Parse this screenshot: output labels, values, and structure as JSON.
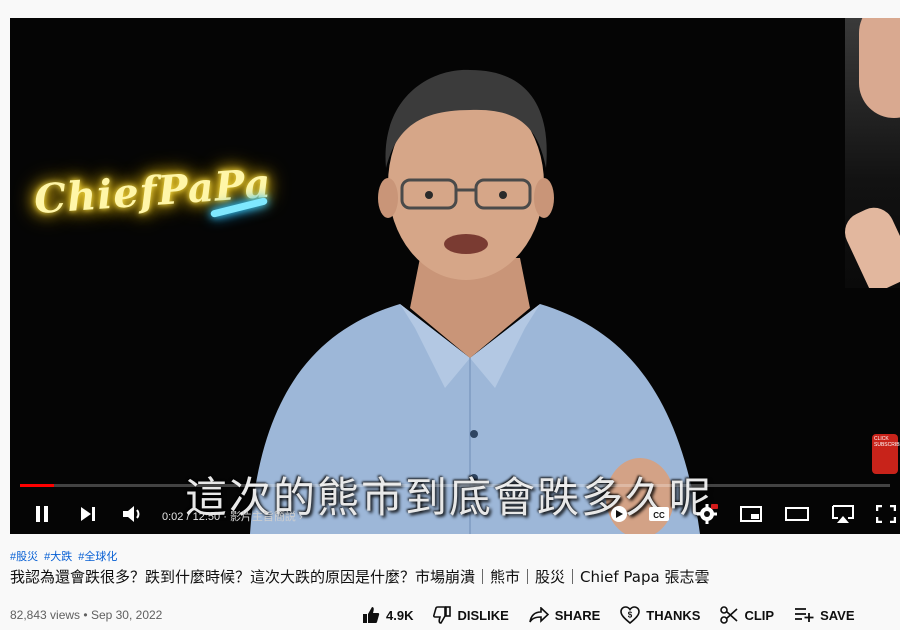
{
  "video": {
    "neon_sign": "ChiefPaPa",
    "subtitle": "這次的熊市到底會跌多久呢",
    "subscribe_badge": "CLICK SUBSCRIBE",
    "progress_fraction": 0.004
  },
  "controls": {
    "current_time": "0:02",
    "duration": "12:50",
    "chapter": "影片主旨簡説",
    "chapter_chevron": "›"
  },
  "info": {
    "tags": [
      "#股災",
      "#大跌",
      "#全球化"
    ],
    "title": "我認為還會跌很多？跌到什麼時候？這次大跌的原因是什麼？市場崩潰｜熊市｜股災｜Chief Papa 張志雲",
    "views": "82,843 views",
    "separator": "•",
    "date": "Sep 30, 2022"
  },
  "actions": {
    "like_count": "4.9K",
    "dislike_label": "DISLIKE",
    "share_label": "SHARE",
    "thanks_label": "THANKS",
    "clip_label": "CLIP",
    "save_label": "SAVE"
  },
  "colors": {
    "accent_red": "#ff0000",
    "link_blue": "#065fd4"
  }
}
